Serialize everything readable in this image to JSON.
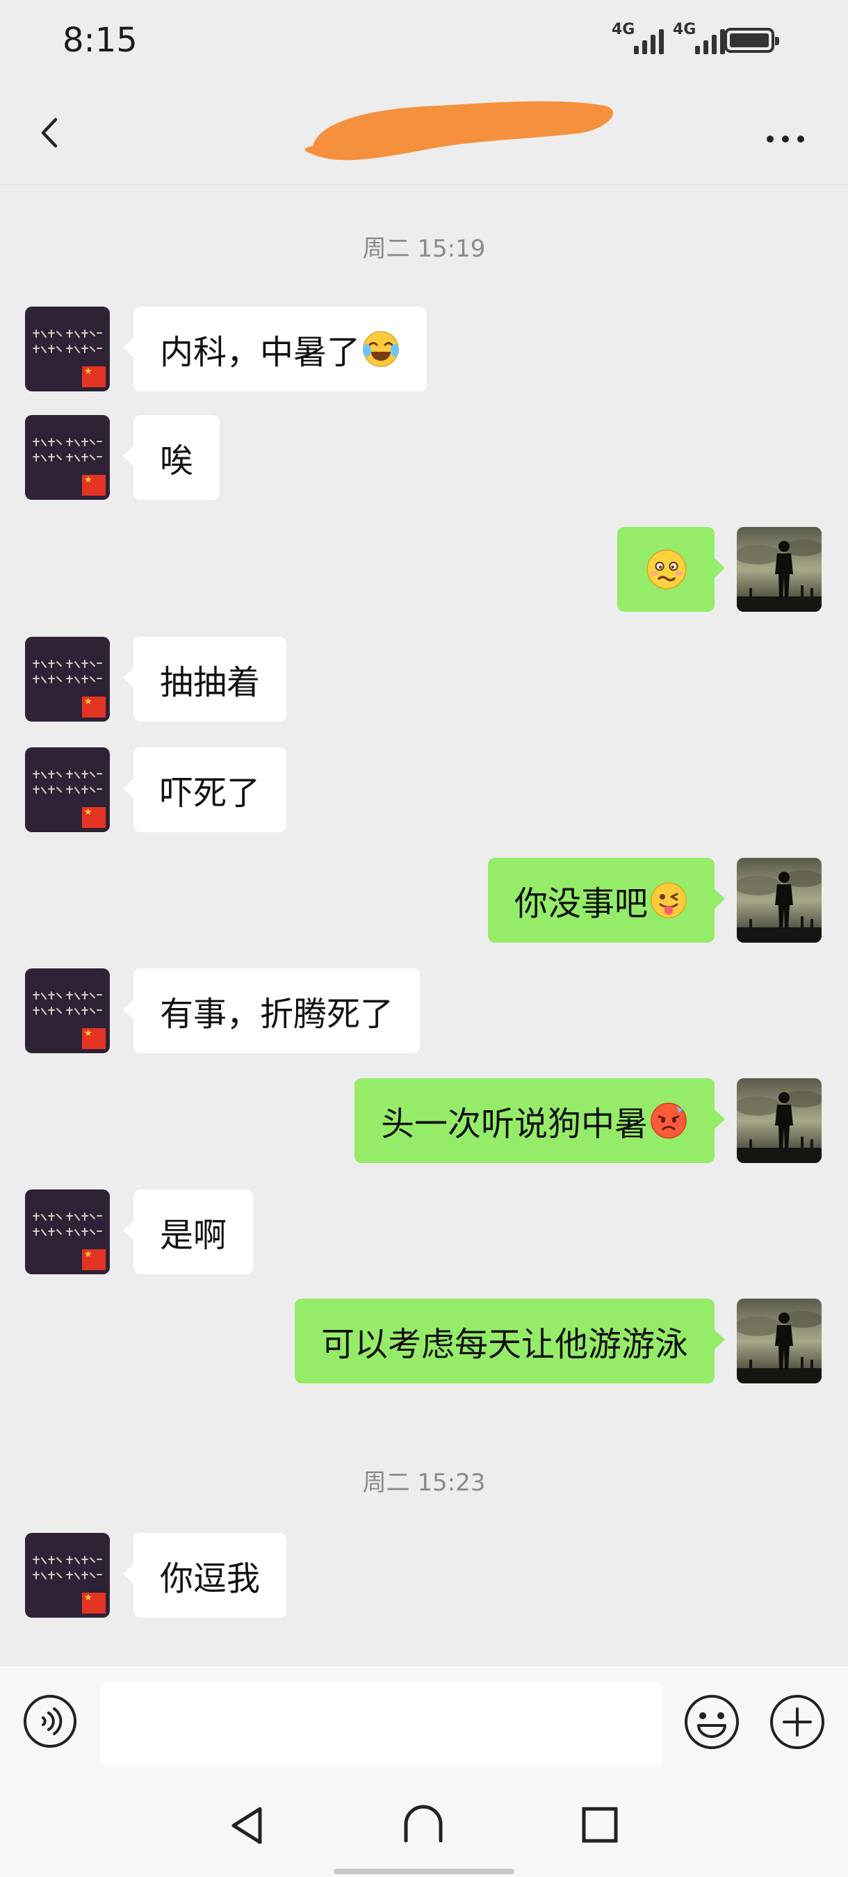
{
  "status_bar": {
    "time": "8:15",
    "network_1": "4G",
    "network_2": "4G"
  },
  "chat": {
    "messages": [
      {
        "type": "time",
        "text": "周二 15:19"
      },
      {
        "type": "msg",
        "side": "left",
        "text": "内科，中暑了",
        "emoji": "face-with-tears-of-joy-emoji"
      },
      {
        "type": "msg",
        "side": "left",
        "text": "唉"
      },
      {
        "type": "msg",
        "side": "right",
        "text": "",
        "emoji": "woozy-face-emoji"
      },
      {
        "type": "msg",
        "side": "left",
        "text": "抽抽着"
      },
      {
        "type": "msg",
        "side": "left",
        "text": "吓死了"
      },
      {
        "type": "msg",
        "side": "right",
        "text": "你没事吧",
        "emoji": "winking-face-with-tongue-emoji"
      },
      {
        "type": "msg",
        "side": "left",
        "text": "有事，折腾死了"
      },
      {
        "type": "msg",
        "side": "right",
        "text": "头一次听说狗中暑",
        "emoji": "hot-face-emoji"
      },
      {
        "type": "msg",
        "side": "left",
        "text": "是啊"
      },
      {
        "type": "msg",
        "side": "right",
        "text": "可以考虑每天让他游游泳"
      },
      {
        "type": "time",
        "text": "周二 15:23"
      },
      {
        "type": "msg",
        "side": "left",
        "text": "你逗我"
      }
    ]
  },
  "input": {
    "value": "",
    "placeholder": ""
  },
  "icons": {
    "back": "back-arrow-icon",
    "more": "more-icon",
    "voice": "voice-input-icon",
    "emoji": "emoji-icon",
    "plus": "plus-icon",
    "sys_back": "system-back-icon",
    "sys_home": "system-home-icon",
    "sys_recents": "system-recents-icon"
  },
  "colors": {
    "background": "#ededed",
    "sent_bubble": "#95ec69",
    "received_bubble": "#ffffff",
    "timestamp": "#8a8a8a",
    "title_redaction": "#f5913e"
  }
}
